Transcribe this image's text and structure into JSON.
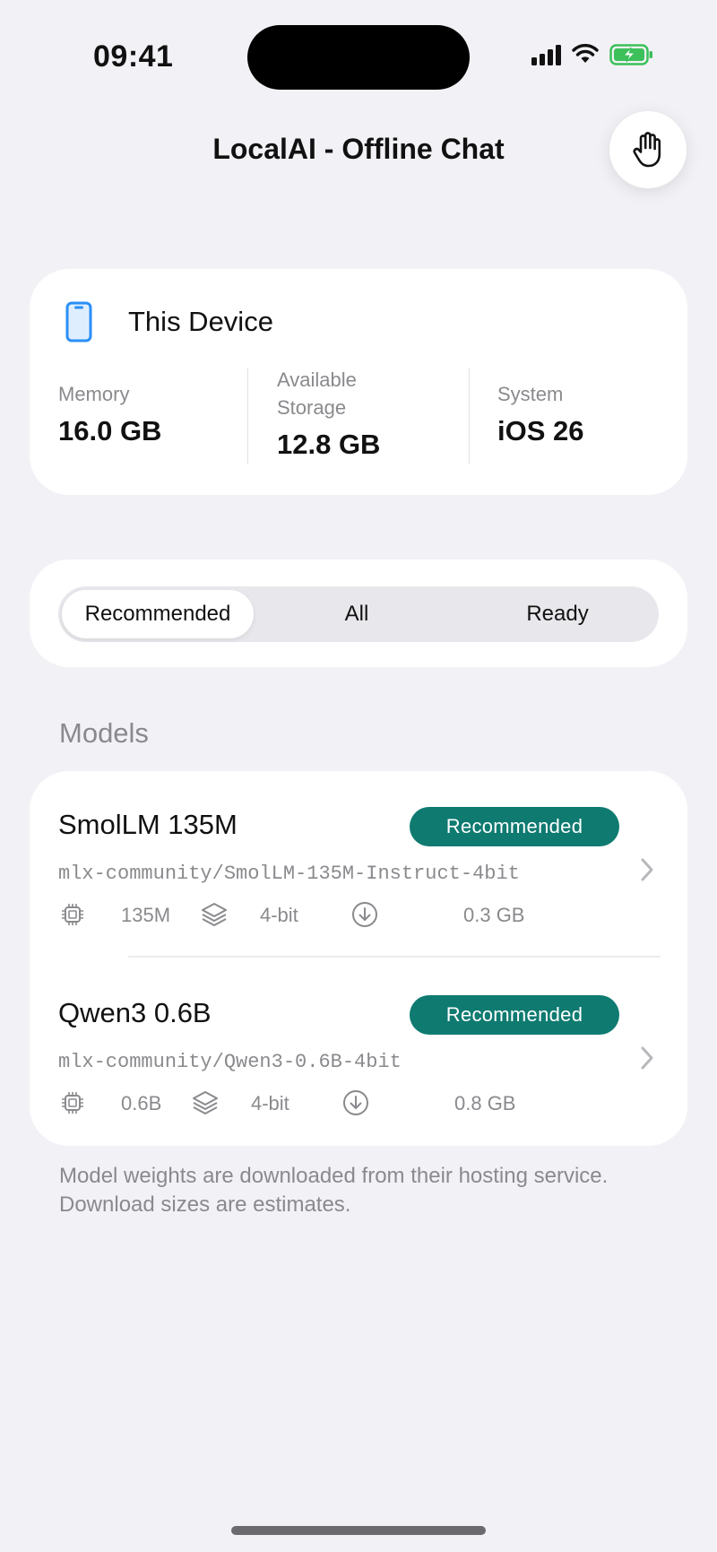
{
  "status_bar": {
    "time": "09:41"
  },
  "nav": {
    "title": "LocalAI - Offline Chat",
    "action_icon": "hand-raised-icon"
  },
  "device": {
    "title": "This Device",
    "icon": "iphone-icon",
    "stats": [
      {
        "label": "Memory",
        "value": "16.0 GB"
      },
      {
        "label": "Available Storage",
        "value": "12.8 GB"
      },
      {
        "label": "System",
        "value": "iOS 26"
      }
    ]
  },
  "filter": {
    "segments": [
      "Recommended",
      "All",
      "Ready"
    ],
    "selected": "Recommended"
  },
  "models_section": {
    "title": "Models",
    "items": [
      {
        "name": "SmolLM 135M",
        "badge": "Recommended",
        "repo": "mlx-community/SmolLM-135M-Instruct-4bit",
        "params": "135M",
        "quant": "4-bit",
        "size": "0.3 GB"
      },
      {
        "name": "Qwen3 0.6B",
        "badge": "Recommended",
        "repo": "mlx-community/Qwen3-0.6B-4bit",
        "params": "0.6B",
        "quant": "4-bit",
        "size": "0.8 GB"
      }
    ],
    "footnote": "Model weights are downloaded from their hosting service. Download sizes are estimates."
  },
  "colors": {
    "accent": "#0e7a70",
    "device_icon": "#2a8ff7",
    "background": "#f2f2f6"
  }
}
